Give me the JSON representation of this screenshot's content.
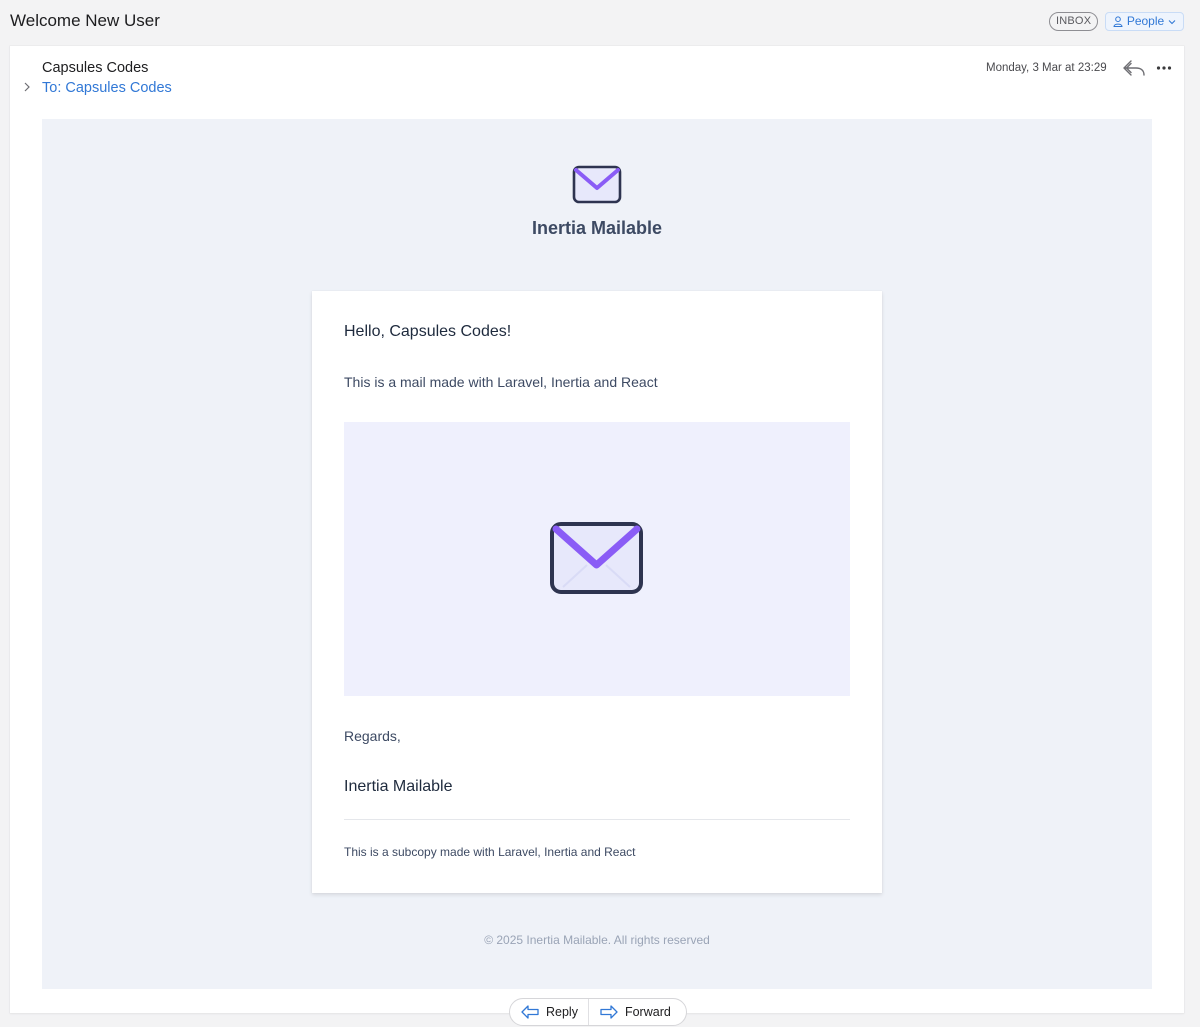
{
  "window": {
    "subject": "Welcome New User",
    "mailbox_tag": "INBOX",
    "category_tag": "People"
  },
  "message": {
    "sender": "Capsules Codes",
    "recipient": "To: Capsules Codes",
    "date": "Monday, 3 Mar at 23:29"
  },
  "email": {
    "brand_name": "Inertia Mailable",
    "greeting": "Hello, Capsules Codes!",
    "intro": "This is a mail made with Laravel, Inertia and React",
    "regards": "Regards,",
    "signature": "Inertia Mailable",
    "subcopy": "This is a subcopy made with Laravel, Inertia and React",
    "footer": "© 2025 Inertia Mailable. All rights reserved"
  },
  "actions": {
    "reply": "Reply",
    "forward": "Forward"
  },
  "icons": {
    "brand_logo": "envelope-icon",
    "hero": "envelope-icon",
    "reply": "reply-arrow-icon",
    "forward": "forward-arrow-icon",
    "more": "ellipsis-icon",
    "people": "person-icon"
  },
  "colors": {
    "link": "#3178d6",
    "email_background": "#eff2f8",
    "hero_background": "#eff0fd",
    "envelope_accent": "#8a5cf6",
    "envelope_outline": "#2e3450"
  }
}
